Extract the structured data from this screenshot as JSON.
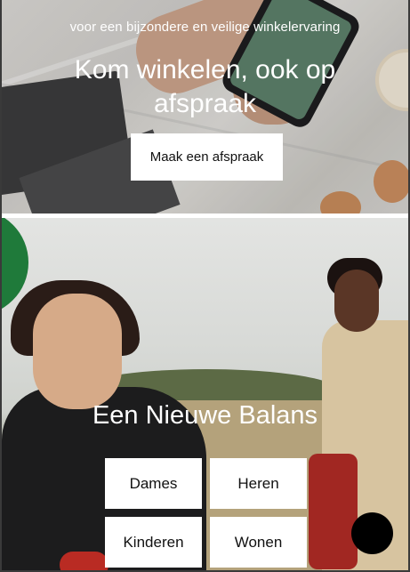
{
  "hero_top": {
    "subtitle": "voor een bijzondere en veilige winkelervaring",
    "title": "Kom winkelen, ook op afspraak",
    "cta_label": "Maak een afspraak"
  },
  "hero_bottom": {
    "title": "Een Nieuwe Balans",
    "categories": [
      {
        "label": "Dames"
      },
      {
        "label": "Heren"
      },
      {
        "label": "Kinderen"
      },
      {
        "label": "Wonen"
      }
    ]
  },
  "chat_button": {
    "icon": "chat-icon",
    "color": "#000000"
  }
}
